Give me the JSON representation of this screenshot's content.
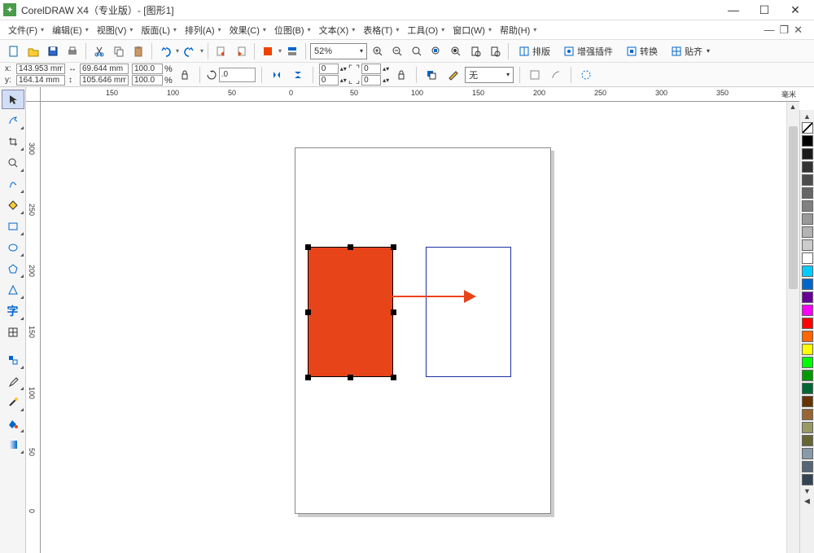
{
  "title": "CorelDRAW X4（专业版）- [图形1]",
  "menu": {
    "file": "文件(F)",
    "edit": "编辑(E)",
    "view": "视图(V)",
    "layout": "版面(L)",
    "arrange": "排列(A)",
    "effects": "效果(C)",
    "bitmaps": "位图(B)",
    "text": "文本(X)",
    "table": "表格(T)",
    "tools": "工具(O)",
    "window": "窗口(W)",
    "help": "帮助(H)"
  },
  "toolbar1": {
    "zoom": "52%",
    "layout_btn": "排版",
    "enhance_btn": "增强插件",
    "convert_btn": "转换",
    "align_btn": "贴齐"
  },
  "propbar": {
    "x_label": "x:",
    "y_label": "y:",
    "x_val": "143.953 mm",
    "y_val": "164.14 mm",
    "w_val": "69.644 mm",
    "h_val": "105.646 mm",
    "scale_x": "100.0",
    "scale_y": "100.0",
    "pct": "%",
    "rotate": ".0",
    "spin1": "0",
    "spin2": "0",
    "spin3": "0",
    "spin4": "0",
    "outline": "无"
  },
  "ruler": {
    "h": [
      "150",
      "100",
      "50",
      "0",
      "50",
      "100",
      "150",
      "200",
      "250",
      "300",
      "350"
    ],
    "v": [
      "300",
      "250",
      "200",
      "150",
      "100",
      "50",
      "0"
    ],
    "unit": "毫米"
  },
  "colors": [
    "#ffffff",
    "#000000",
    "#191919",
    "#333333",
    "#4d4d4d",
    "#666666",
    "#808080",
    "#999999",
    "#b3b3b3",
    "#cccccc",
    "#ffffff",
    "#2b0000",
    "#660000",
    "#990000",
    "#cc0000",
    "#ff0000",
    "#cc3333",
    "#00cc00",
    "#009900",
    "#ffff00",
    "#0000ff",
    "#00ffff",
    "#ff00ff",
    "#ffcc00",
    "#996633",
    "#663300",
    "#333399",
    "#660099",
    "#999966",
    "#666633"
  ]
}
